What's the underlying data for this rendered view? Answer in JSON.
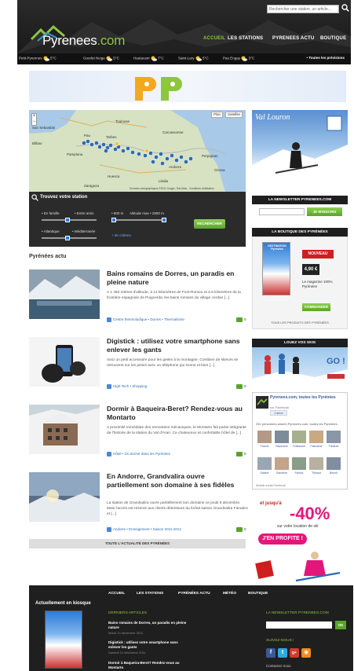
{
  "header": {
    "search_placeholder": "Rechercher une station, un article...",
    "logo_name": "Pyrenees",
    "logo_domain": ".com",
    "nav": [
      {
        "label": "ACCUEIL",
        "active": true
      },
      {
        "label": "LES STATIONS",
        "active": false
      },
      {
        "label": "PYRENEES ACTU",
        "active": false
      },
      {
        "label": "BOUTIQUE",
        "active": false
      }
    ],
    "weather": [
      {
        "place": "Petit-Pyrennes",
        "temp": "5°C"
      },
      {
        "place": "Gourlet Neige",
        "temp": "5°C"
      },
      {
        "place": "Hautacam",
        "temp": "7°C"
      },
      {
        "place": "Saint-Lary",
        "temp": "5°C"
      },
      {
        "place": "Pau Engay",
        "temp": "3°C"
      }
    ],
    "weather_all": "• Toutes les prévisions"
  },
  "map": {
    "type_plan": "Plan",
    "type_sat": "Satellite",
    "cities": [
      "Toulouse",
      "Tarbes",
      "Pau",
      "Perpignan",
      "Andorra",
      "Girona",
      "Lleida",
      "Huesca",
      "Pamplona",
      "San Sebastián",
      "Bilbao",
      "Zaragoza",
      "Carcassonne"
    ],
    "attribution": "Données cartographiques ©2011 Google, Tele Atlas - Conditions d'utilisation"
  },
  "finder": {
    "title": "Trouvez votre station",
    "opt_famille": "• En famille",
    "opt_amis": "• Entre amis",
    "opt_atlantique": "• Atlantique",
    "opt_med": "• Méditerranée",
    "alt_min": "• 800 m",
    "alt_max": "Altitude max • 2900 m",
    "criteria": "+ de critères",
    "button": "RECHERCHER"
  },
  "section_title": "Pyrénées actu",
  "articles": [
    {
      "title": "Bains romains de Dorres, un paradis en pleine nature",
      "excerpt": "A 1 450 mètres d'altitude, à 14 kilomètres de Font-Romeu et à 8 kilomètres de la frontière espagnole de Puigcerda, les bains romains du village cerdan [...]",
      "tags": "Centre thermoludique • Dorres • Thermalisme",
      "comments": "0"
    },
    {
      "title": "Digistick : utilisez votre smartphone sans enlever les gants",
      "excerpt": "Voici un petit accessoire pour les geeks à la montagne. Combien de skieurs se retrouvent sur les pistes avec un téléphone qui sonne et bien [...]",
      "tags": "High-Tech • Shopping",
      "comments": "0"
    },
    {
      "title": "Dormir à Baqueira-Beret? Rendez-vous au Montarto",
      "excerpt": "A proximité immédiate des remontées mécaniques, le Montarto fait partie intégrante de l'histoire de la station du Val d'Aran. Ce chaleureux et confortable hôtel de [...]",
      "tags": "Hôtel • Où dormir dans les Pyrénées",
      "comments": "0"
    },
    {
      "title": "En Andorre, Grandvalira ouvre partiellement son domaine à ses fidèles",
      "excerpt": "La station de Grandvalira ouvre partiellement son domaine ce jeudi 8 décembre. Mais l'accès est réservé aux clients détenteurs du forfait saison Grandvalira Fanatics et [...]",
      "tags": "Andorre • Enneigement • Saison 2011-2012",
      "comments": "0"
    }
  ],
  "all_news": "TOUTE L'ACTUALITÉ DES PYRÉNÉES",
  "sidebar": {
    "valloron_logo": "Val Louron",
    "newsletter_title": "LA NEWSLETTER PYRENEES.COM",
    "newsletter_btn": "JE M'INSCRIS",
    "shop_title": "LA BOUTIQUE DES PYRÉNÉES",
    "mag_title": "DESTINATION Pyrénées",
    "nouveau": "NOUVEAU",
    "price": "4,90 €",
    "mag_desc": "Le magazine 100% Pyrénées",
    "commander": "COMMANDER",
    "all_products": "TOUS LES PRODUITS DES PYRÉNÉES",
    "ski_title": "LOUEZ VOS SKIS",
    "ski_go": "GO !",
    "fb_title": "Pyrenees.com, toutes les Pyrénées",
    "fb_sub": "sur Facebook",
    "fb_like": "J'aime",
    "fb_count": "251 personnes aiment Pyrenees.com, toutes les Pyrénées.",
    "fb_fans": [
      "Franck",
      "Stephanie",
      "Guillaume",
      "Pascaline",
      "Frederic",
      "Sabine",
      "Sandrine",
      "Patrick",
      "Thibaut",
      "Benoit"
    ],
    "fb_plugin": "Module social Facebook",
    "promo_upto": "et jusqu'à",
    "promo_pct": "-40%",
    "promo_loc": "sur votre location de ski",
    "promo_btn": "J'EN PROFITE !"
  },
  "footer": {
    "kiosk_title": "Actuellement en kiosque",
    "nav": [
      "ACCUEIL",
      "LES STATIONS",
      "PYRÉNÉES ACTU",
      "MÉTÉO",
      "BOUTIQUE"
    ],
    "latest_title": "DERNIERS ARTICLES",
    "latest": [
      {
        "title": "Bains romains de Dorres, un paradis en pleine nature",
        "date": "Mardi 13 décembre 2011"
      },
      {
        "title": "Digistick : utilisez votre smartphone sans enlever les gants",
        "date": "Samedi 10 décembre 2011"
      },
      {
        "title": "Dormir à Baqueira-Beret? Rendez-vous au Montarto",
        "date": ""
      }
    ],
    "newsletter_title": "LA NEWSLETTER PYRENEES.COM",
    "ok": "OK",
    "follow": "SUIVEZ-NOUS !",
    "contact": "Contactez-nous"
  },
  "colors": {
    "accent_green": "#8dc63f",
    "header_dark": "#1e1e1e",
    "link_blue": "#2e6bb3",
    "promo_pink": "#e3177a"
  }
}
